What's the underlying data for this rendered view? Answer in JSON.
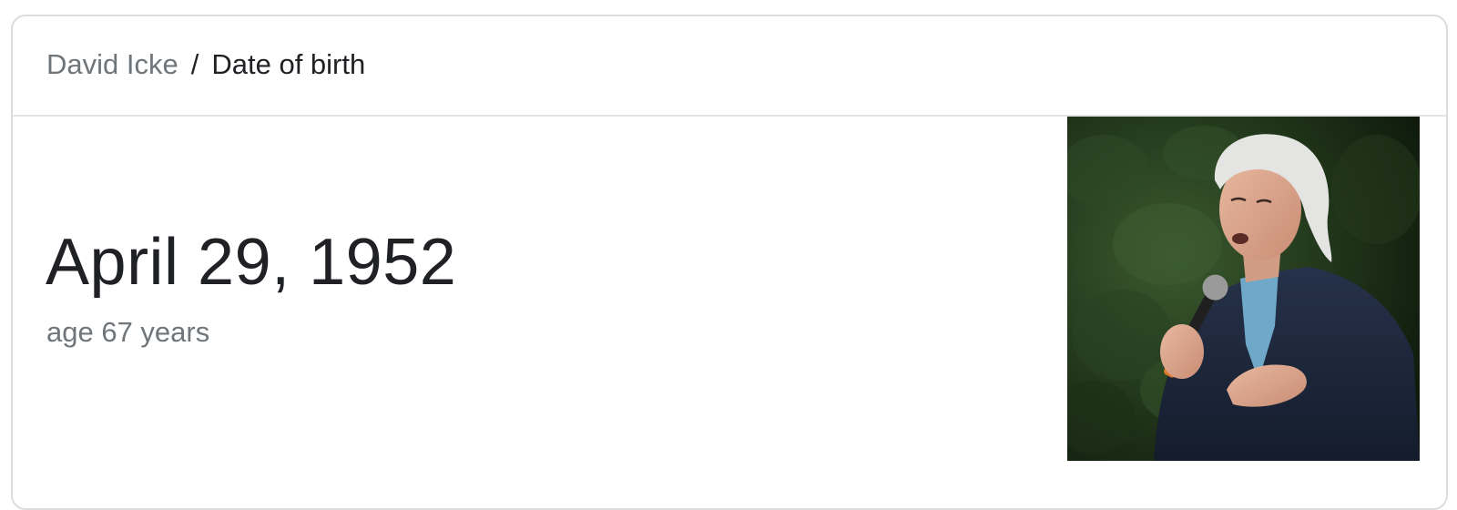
{
  "breadcrumb": {
    "parent": "David Icke",
    "separator": "/",
    "current": "Date of birth"
  },
  "answer": {
    "value": "April 29, 1952",
    "detail": "age 67 years"
  },
  "photo": {
    "subject": "person-speaking-with-microphone"
  }
}
